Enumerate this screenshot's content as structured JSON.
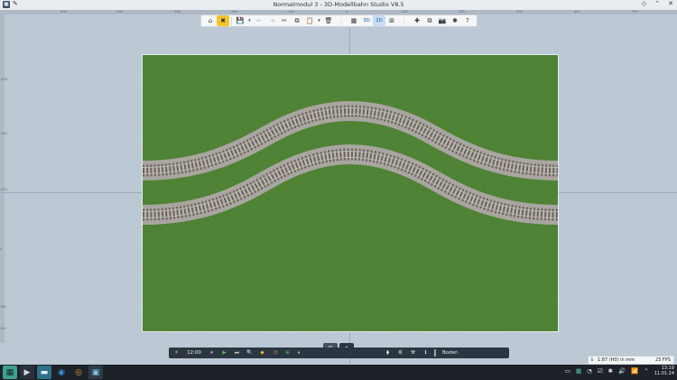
{
  "window": {
    "title": "Normalmodul 3 - 3D-Modellbahn Studio V8.5",
    "controls": [
      "◇",
      "⌃",
      "✕"
    ]
  },
  "ruler": {
    "top_ticks": [
      "-600",
      "-400",
      "-300",
      "-200",
      "-100",
      "0",
      "100",
      "200",
      "300",
      "400",
      "500"
    ],
    "left_ticks": [
      "-400",
      "-300",
      "-200",
      "0",
      "100",
      "200"
    ]
  },
  "toolbar": {
    "home": "⌂",
    "edit": "✖",
    "save": "💾",
    "save_menu": "▾",
    "undo": "←",
    "redo": "→",
    "cut": "✂",
    "copy": "⧉",
    "paste": "📋",
    "paste_menu": "▾",
    "delete": "🗑",
    "properties": "⋮",
    "grid3": "▦",
    "mode3d": "3D",
    "mode2d": "2D",
    "grid": "⊞",
    "align": "⋮",
    "add": "✚",
    "duplicate": "⧉",
    "camera": "📷",
    "plugins": "✱",
    "help": "?"
  },
  "bottombar": {
    "sun": "☀",
    "time": "12:00",
    "pause": "⏸",
    "play": "▶",
    "skip": "⏭",
    "search": "🔍",
    "layers": "◆",
    "shuffle": "⤨",
    "track": "⊞",
    "track_menu": "▾",
    "sliders": "⧫",
    "settings": "⚙",
    "tools": "⚒",
    "info": "ℹ",
    "layer_label": "Boden"
  },
  "viewtabs": {
    "grid": "⊞",
    "terrain": "⛰"
  },
  "status": {
    "info": "ℹ",
    "scale": "1:87 (H0) in mm",
    "fps": "23 FPS"
  },
  "taskbar": {
    "apps": [
      "▦",
      "▶",
      "▬",
      "◉",
      "◎",
      "▣"
    ],
    "tray_icons": [
      "▭",
      "▦",
      "◔",
      "☑",
      "✱",
      "🔊",
      "📶",
      "⌃"
    ],
    "time": "13:19",
    "date": "11.01.24"
  },
  "colors": {
    "accent": "#f2c52c",
    "grass": "#3f7a24",
    "rail": "#8a8886",
    "taskbar": "#1d2229",
    "bottombar": "#2c3542"
  }
}
